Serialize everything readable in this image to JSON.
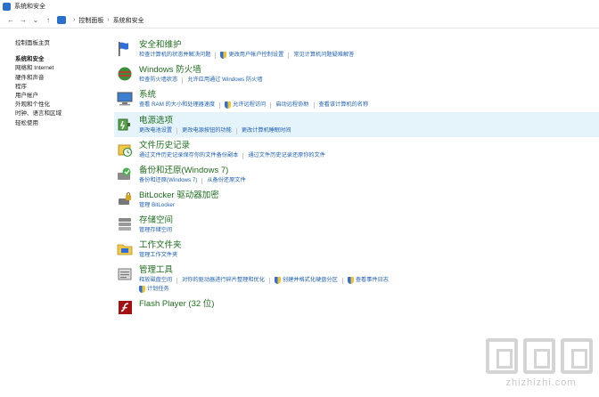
{
  "window": {
    "title": "系统和安全"
  },
  "address": {
    "nav": {
      "back": "←",
      "forward": "→",
      "recent": "⌄",
      "up": "↑"
    },
    "separator": "›",
    "crumbs": [
      "控制面板",
      "系统和安全"
    ]
  },
  "sidebar": {
    "items": [
      "控制面板主页",
      "系统和安全",
      "网络和 Internet",
      "硬件和声音",
      "程序",
      "用户帐户",
      "外观和个性化",
      "时钟、语言和区域",
      "轻松使用"
    ]
  },
  "categories": [
    {
      "title": "安全和维护",
      "icon": "flag-icon",
      "links": [
        {
          "t": "检查计算机的状态并解决问题",
          "s": false
        },
        {
          "t": "更改用户帐户控制设置",
          "s": true
        },
        {
          "t": "常见计算机问题疑难解答",
          "s": false
        }
      ]
    },
    {
      "title": "Windows 防火墙",
      "icon": "firewall-icon",
      "links": [
        {
          "t": "检查防火墙状态",
          "s": false
        },
        {
          "t": "允许应用通过 Windows 防火墙",
          "s": false
        }
      ]
    },
    {
      "title": "系统",
      "icon": "computer-icon",
      "links": [
        {
          "t": "查看 RAM 的大小和处理器速度",
          "s": false
        },
        {
          "t": "允许远程访问",
          "s": true
        },
        {
          "t": "启动远程协助",
          "s": false
        },
        {
          "t": "查看该计算机的名称",
          "s": false
        }
      ]
    },
    {
      "title": "电源选项",
      "icon": "power-icon",
      "links": [
        {
          "t": "更改电池设置",
          "s": false
        },
        {
          "t": "更改电源按钮的功能",
          "s": false
        },
        {
          "t": "更改计算机睡眠时间",
          "s": false
        }
      ]
    },
    {
      "title": "文件历史记录",
      "icon": "file-history-icon",
      "links": [
        {
          "t": "通过文件历史记录保存你的文件备份副本",
          "s": false
        },
        {
          "t": "通过文件历史记录还原你的文件",
          "s": false
        }
      ]
    },
    {
      "title": "备份和还原(Windows 7)",
      "icon": "backup-icon",
      "links": [
        {
          "t": "备份和还原(Windows 7)",
          "s": false
        },
        {
          "t": "从备份还原文件",
          "s": false
        }
      ]
    },
    {
      "title": "BitLocker 驱动器加密",
      "icon": "bitlocker-icon",
      "links": [
        {
          "t": "管理 BitLocker",
          "s": false
        }
      ]
    },
    {
      "title": "存储空间",
      "icon": "storage-icon",
      "links": [
        {
          "t": "管理存储空间",
          "s": false
        }
      ]
    },
    {
      "title": "工作文件夹",
      "icon": "work-folders-icon",
      "links": [
        {
          "t": "管理工作文件夹",
          "s": false
        }
      ]
    },
    {
      "title": "管理工具",
      "icon": "admin-tools-icon",
      "links": [
        {
          "t": "释放磁盘空间",
          "s": false
        },
        {
          "t": "对你的驱动器进行碎片整理和优化",
          "s": false
        },
        {
          "t": "创建并格式化硬盘分区",
          "s": true
        },
        {
          "t": "查看事件日志",
          "s": true
        },
        {
          "t": "计划任务",
          "s": true
        }
      ]
    },
    {
      "title": "Flash Player (32 位)",
      "icon": "flash-icon",
      "links": []
    }
  ],
  "watermark": {
    "text": "zhizhizhi.com"
  },
  "colors": {
    "category_title": "#1e6e1e",
    "link": "#1e5fb4",
    "highlight": "#e5f3fb",
    "shield_blue": "#2f6fd6",
    "shield_yellow": "#f2c12e"
  }
}
